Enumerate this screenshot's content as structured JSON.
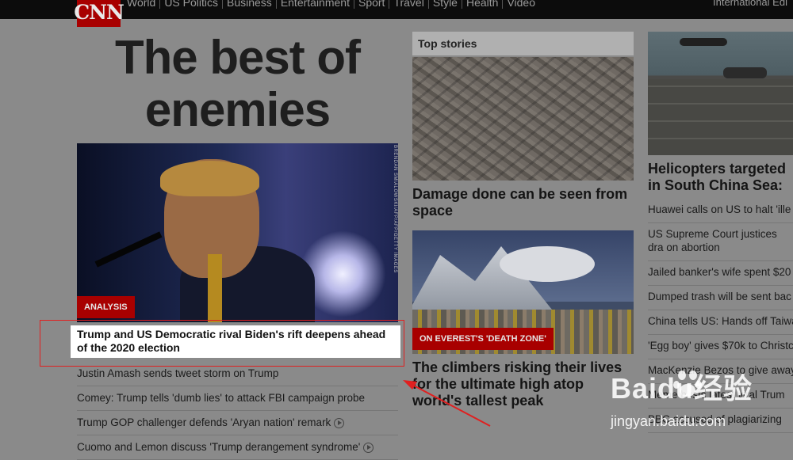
{
  "header": {
    "logo": "CNN",
    "nav": [
      "World",
      "US Politics",
      "Business",
      "Entertainment",
      "Sport",
      "Travel",
      "Style",
      "Health",
      "Video"
    ],
    "edition": "International Edi"
  },
  "lead": {
    "headline": "The best of enemies",
    "photo_credit": "BRENDAN SMIALOWSKI/AFP/AFP/GETTY IMAGES",
    "badge": "ANALYSIS",
    "caption": "Trump and US Democratic rival Biden's rift deepens ahead of the 2020 election",
    "links": [
      {
        "text": "Justin Amash sends tweet storm on Trump",
        "video": false
      },
      {
        "text": "Comey: Trump tells 'dumb lies' to attack FBI campaign probe",
        "video": false
      },
      {
        "text": "Trump GOP challenger defends 'Aryan nation' remark",
        "video": true
      },
      {
        "text": "Cuomo and Lemon discuss 'Trump derangement syndrome'",
        "video": true
      }
    ]
  },
  "top_stories": {
    "label": "Top stories",
    "story1_title": "Damage done can be seen from space",
    "story2_badge": "ON EVEREST'S 'DEATH ZONE'",
    "story2_title": "The climbers risking their lives for the ultimate high atop world's tallest peak"
  },
  "right": {
    "title": "Helicopters targeted in South China Sea: s",
    "links": [
      "Huawei calls on US to halt 'ille",
      "US Supreme Court justices dra on abortion",
      "Jailed banker's wife spent $20",
      "Dumped trash will be sent bac",
      "China tells US: Hands off Taiwa",
      "'Egg boy' gives $70k to Christc",
      "MacKenzie Bezos to give away",
      "Meme busts latest viral Trum",
      "BBC accused of plagiarizing"
    ]
  },
  "watermark": {
    "logo": "Baidu经验",
    "url": "jingyan.baidu.com"
  },
  "colors": {
    "brand_red": "#a80000",
    "highlight_box": "#e02020"
  }
}
